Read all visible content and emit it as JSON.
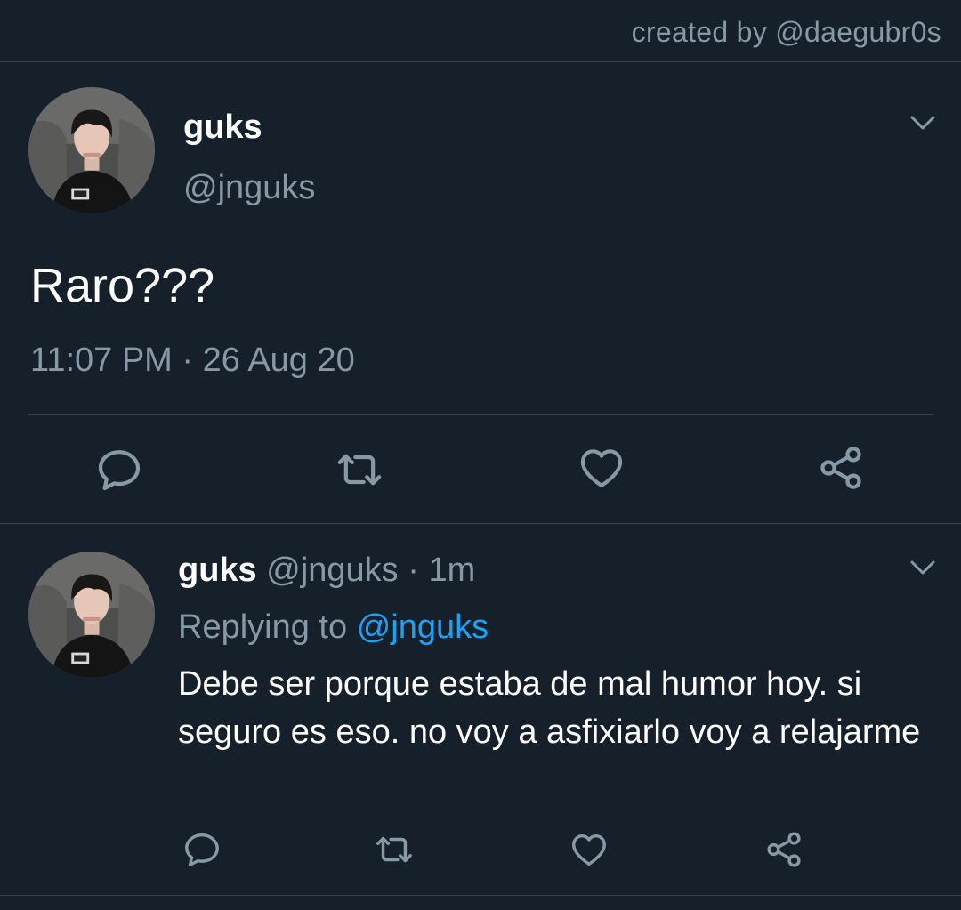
{
  "credit": "created by @daegubr0s",
  "main_tweet": {
    "name": "guks",
    "handle": "@jnguks",
    "text": "Raro???",
    "timestamp": "11:07 PM · 26 Aug 20",
    "actions": [
      "reply-icon",
      "retweet-icon",
      "like-icon",
      "share-icon"
    ]
  },
  "reply_tweet": {
    "name": "guks",
    "handle_time": "@jnguks · 1m",
    "replying_prefix": "Replying to",
    "replying_mention": "@jnguks",
    "text": "Debe ser porque estaba de mal humor hoy. si seguro es eso. no voy a asfixiarlo voy a relajarme",
    "actions": [
      "reply-icon",
      "retweet-icon",
      "like-icon",
      "share-icon"
    ]
  },
  "colors": {
    "background": "#15202b",
    "secondary_text": "#8899a6",
    "divider": "#38444d",
    "link": "#1da1f2"
  }
}
